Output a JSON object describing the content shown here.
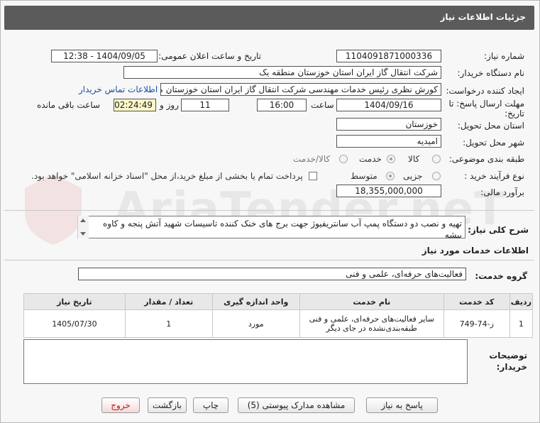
{
  "header": {
    "title": "جزئیات اطلاعات نیاز"
  },
  "form": {
    "need_number": {
      "label": "شماره نیاز:",
      "value": "1104091871000336"
    },
    "announce_datetime": {
      "label": "تاریخ و ساعت اعلان عمومی:",
      "value": "1404/09/05 - 12:38"
    },
    "buyer_org": {
      "label": "نام دستگاه خریدار:",
      "value": "شرکت انتقال گاز ایران  استان خوزستان منطقه یک"
    },
    "creator": {
      "label": "ایجاد کننده درخواست:",
      "value": "کورش نظری رئیس خدمات مهندسی شرکت انتقال گاز ایران  استان خوزستان منط",
      "contact_link": "اطلاعات تماس خریدار"
    },
    "deadline": {
      "label_line1": "مهلت ارسال پاسخ: تا",
      "label_line2": "تاریخ:",
      "date": "1404/09/16",
      "time_label": "ساعت",
      "time": "16:00",
      "days": "11",
      "days_label": "روز و",
      "remaining": "02:24:49",
      "remaining_label": "ساعت باقی مانده"
    },
    "delivery_province": {
      "label": "استان محل تحویل:",
      "value": "خوزستان"
    },
    "delivery_city": {
      "label": "شهر محل تحویل:",
      "value": "امیدیه"
    },
    "category": {
      "label": "طبقه بندی موضوعی:",
      "options": [
        "کالا",
        "خدمت",
        "کالا/خدمت"
      ],
      "selected": "خدمت"
    },
    "purchase_process": {
      "label": "نوع فرآیند خرید :",
      "options": [
        "جزیی",
        "متوسط"
      ],
      "selected": "متوسط",
      "payment_note": "پرداخت تمام یا بخشی از مبلغ خرید،از محل \"اسناد خزانه اسلامی\" خواهد بود."
    },
    "estimate": {
      "label": "برآورد مالی:",
      "value": "18,355,000,000"
    }
  },
  "summary": {
    "label": "شرح کلی نیاز:",
    "text": "تهیه و نصب دو دستگاه پمپ آب سانتریفیوژ جهت برج های خنک کننده تاسیسات شهید آتش پنجه  و کاوه پیشه"
  },
  "services": {
    "section_title": "اطلاعات خدمات مورد نیاز",
    "group_label": "گروه خدمت:",
    "group_value": "فعالیت‌های حرفه‌ای، علمی و فنی",
    "table": {
      "headers": [
        "ردیف",
        "کد خدمت",
        "نام خدمت",
        "واحد اندازه گیری",
        "تعداد / مقدار",
        "تاریخ نیاز"
      ],
      "rows": [
        {
          "row": "1",
          "code": "ز-74-749",
          "name": "سایر فعالیت‌های حرفه‌ای، علمی و فنی طبقه‌بندی‌نشده در جای دیگر",
          "unit": "مورد",
          "qty": "1",
          "date": "1405/07/30"
        }
      ]
    }
  },
  "buyer_notes": {
    "label_line1": "توضیحات",
    "label_line2": "خریدار:",
    "value": ""
  },
  "buttons": {
    "reply": "پاسخ به نیاز",
    "docs": "مشاهده مدارک پیوستی (5)",
    "print": "چاپ",
    "back": "بازگشت",
    "exit": "خروج"
  },
  "watermark": "AriaTender.neT",
  "colors": {
    "header_bg": "#5b5b5b",
    "link": "#1a4fa8",
    "timer_bg": "#fbf7c7",
    "exit_red": "#c21a1a"
  }
}
